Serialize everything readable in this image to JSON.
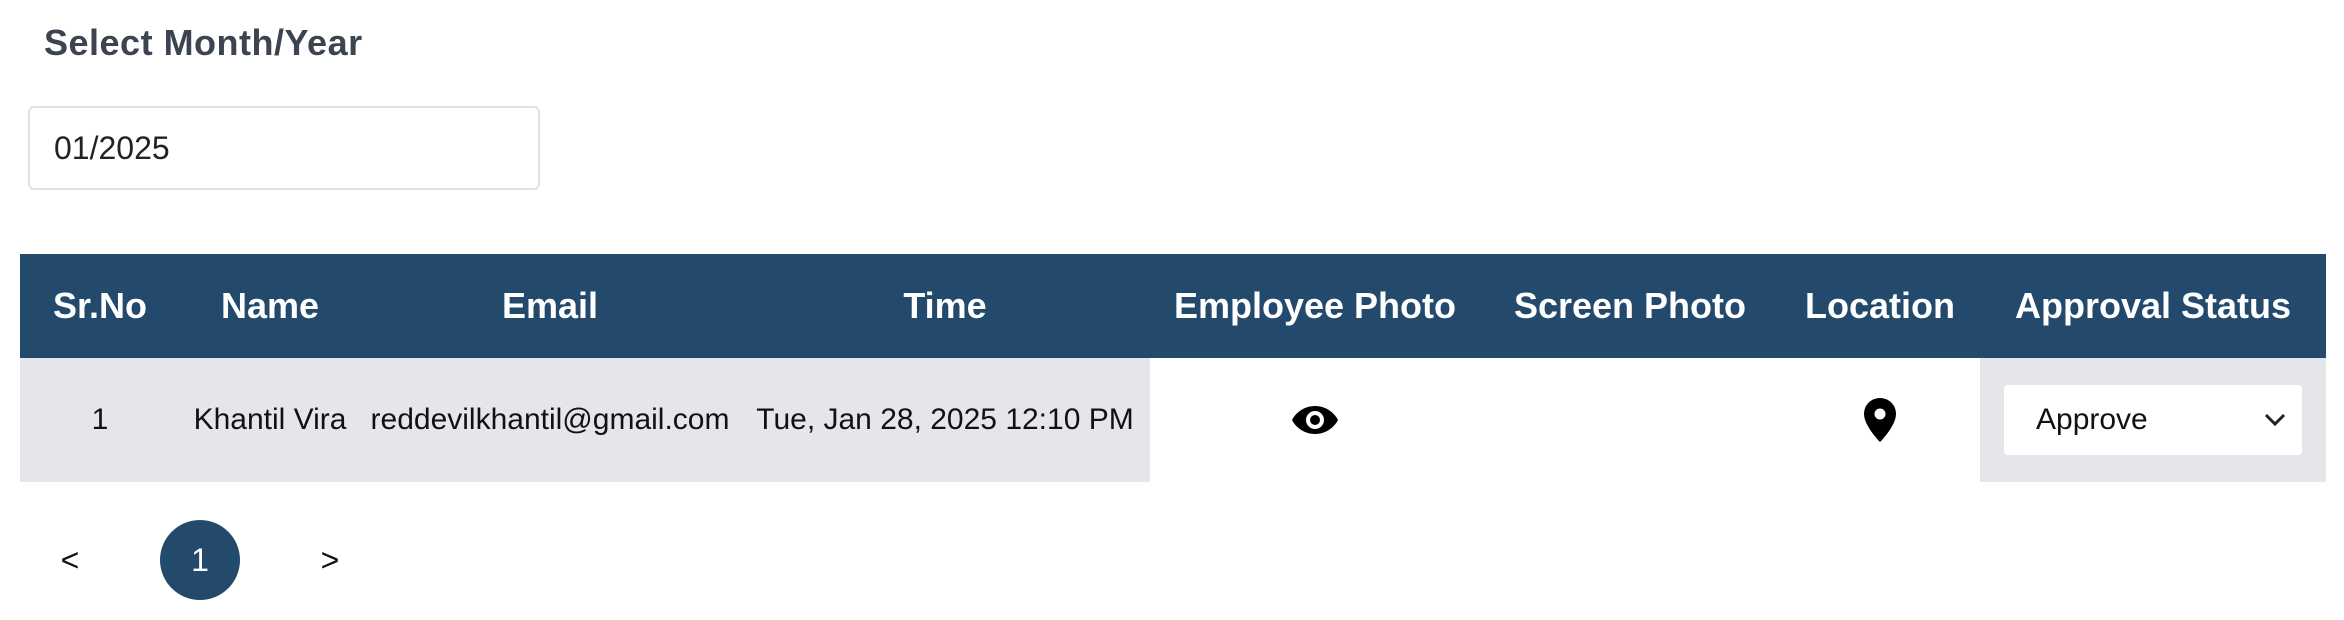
{
  "filter": {
    "label": "Select Month/Year",
    "value": "01/2025"
  },
  "table": {
    "headers": [
      "Sr.No",
      "Name",
      "Email",
      "Time",
      "Employee Photo",
      "Screen Photo",
      "Location",
      "Approval Status"
    ],
    "rows": [
      {
        "sr_no": "1",
        "name": "Khantil Vira",
        "email": "reddevilkhantil@gmail.com",
        "time": "Tue, Jan 28, 2025 12:10 PM",
        "employee_photo_icon": "eye-icon",
        "screen_photo": "---",
        "location_icon": "map-pin-icon",
        "approval_status": "Approve"
      }
    ]
  },
  "pagination": {
    "prev": "<",
    "current_page": "1",
    "next": ">"
  },
  "colors": {
    "header_bg": "#234a6c",
    "row_bg": "#e5e6e9",
    "page_active": "#234a6c"
  }
}
